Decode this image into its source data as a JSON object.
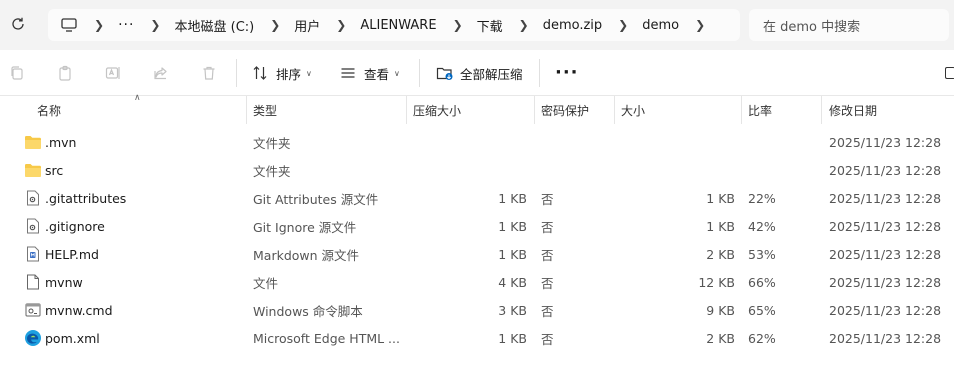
{
  "address": {
    "crumbs": [
      "本地磁盘 (C:)",
      "用户",
      "ALIENWARE",
      "下载",
      "demo.zip",
      "demo"
    ],
    "overflow": "···",
    "search_placeholder": "在 demo 中搜索"
  },
  "toolbar": {
    "sort_label": "排序",
    "view_label": "查看",
    "extract_label": "全部解压缩",
    "more_label": "···",
    "icons": [
      "copy-icon",
      "paste-icon",
      "rename-icon",
      "share-icon",
      "delete-icon"
    ]
  },
  "columns": {
    "name": "名称",
    "type": "类型",
    "compressed_size": "压缩大小",
    "password": "密码保护",
    "size": "大小",
    "ratio": "比率",
    "modified": "修改日期"
  },
  "files": [
    {
      "icon": "folder-icon",
      "name": ".mvn",
      "type": "文件夹",
      "compressed_size": "",
      "password": "",
      "size": "",
      "ratio": "",
      "modified": "2025/11/23 12:28"
    },
    {
      "icon": "folder-icon",
      "name": "src",
      "type": "文件夹",
      "compressed_size": "",
      "password": "",
      "size": "",
      "ratio": "",
      "modified": "2025/11/23 12:28"
    },
    {
      "icon": "config-file-icon",
      "name": ".gitattributes",
      "type": "Git Attributes 源文件",
      "compressed_size": "1 KB",
      "password": "否",
      "size": "1 KB",
      "ratio": "22%",
      "modified": "2025/11/23 12:28"
    },
    {
      "icon": "config-file-icon",
      "name": ".gitignore",
      "type": "Git Ignore 源文件",
      "compressed_size": "1 KB",
      "password": "否",
      "size": "1 KB",
      "ratio": "42%",
      "modified": "2025/11/23 12:28"
    },
    {
      "icon": "markdown-file-icon",
      "name": "HELP.md",
      "type": "Markdown 源文件",
      "compressed_size": "1 KB",
      "password": "否",
      "size": "2 KB",
      "ratio": "53%",
      "modified": "2025/11/23 12:28"
    },
    {
      "icon": "blank-file-icon",
      "name": "mvnw",
      "type": "文件",
      "compressed_size": "4 KB",
      "password": "否",
      "size": "12 KB",
      "ratio": "66%",
      "modified": "2025/11/23 12:28"
    },
    {
      "icon": "cmd-file-icon",
      "name": "mvnw.cmd",
      "type": "Windows 命令脚本",
      "compressed_size": "3 KB",
      "password": "否",
      "size": "9 KB",
      "ratio": "65%",
      "modified": "2025/11/23 12:28"
    },
    {
      "icon": "edge-file-icon",
      "name": "pom.xml",
      "type": "Microsoft Edge HTML ...",
      "compressed_size": "1 KB",
      "password": "否",
      "size": "2 KB",
      "ratio": "62%",
      "modified": "2025/11/23 12:28"
    }
  ]
}
